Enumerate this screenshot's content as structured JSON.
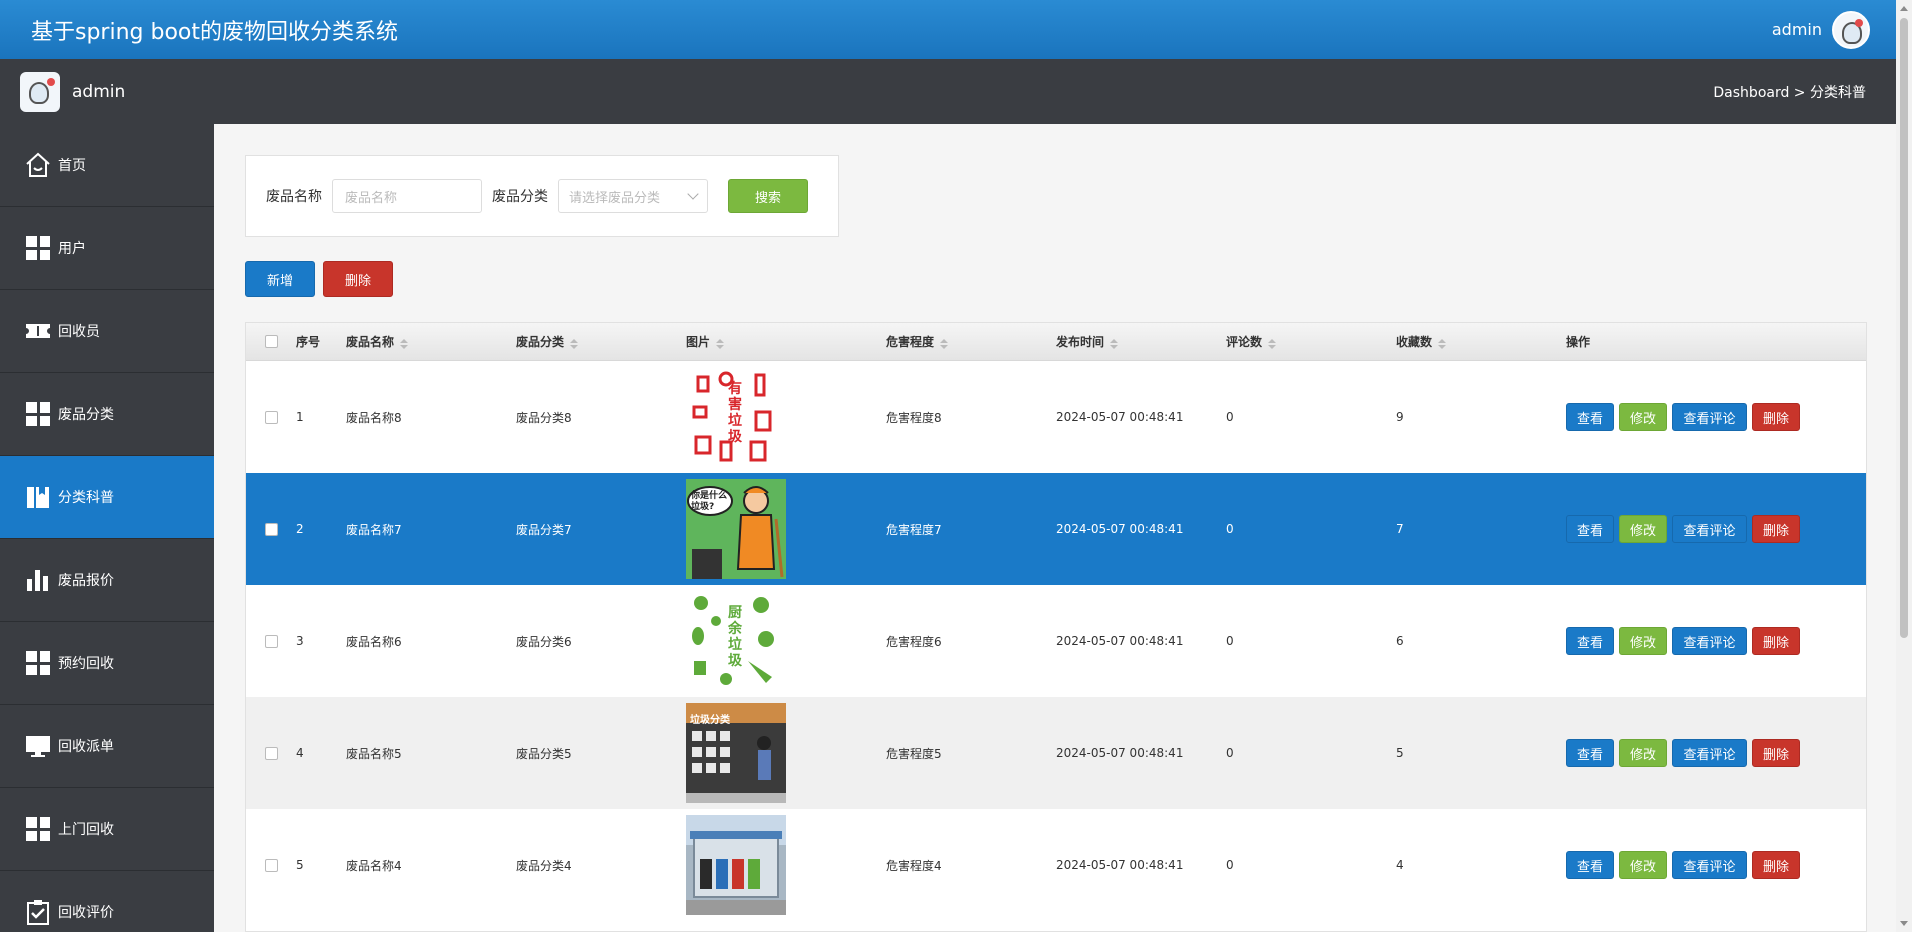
{
  "header": {
    "title": "基于spring boot的废物回收分类系统",
    "username": "admin"
  },
  "subbar": {
    "username": "admin",
    "breadcrumb": "Dashboard > 分类科普"
  },
  "sidebar": {
    "items": [
      {
        "label": "首页",
        "icon": "home-icon"
      },
      {
        "label": "用户",
        "icon": "grid-icon"
      },
      {
        "label": "回收员",
        "icon": "ticket-icon"
      },
      {
        "label": "废品分类",
        "icon": "grid-icon"
      },
      {
        "label": "分类科普",
        "icon": "book-icon",
        "active": true
      },
      {
        "label": "废品报价",
        "icon": "bar-chart-icon"
      },
      {
        "label": "预约回收",
        "icon": "grid-icon"
      },
      {
        "label": "回收派单",
        "icon": "monitor-icon"
      },
      {
        "label": "上门回收",
        "icon": "grid-icon"
      },
      {
        "label": "回收评价",
        "icon": "clipboard-check-icon"
      }
    ]
  },
  "search": {
    "name_label": "废品名称",
    "name_placeholder": "废品名称",
    "category_label": "废品分类",
    "category_placeholder": "请选择废品分类",
    "search_button": "搜索"
  },
  "toolbar": {
    "add_label": "新增",
    "delete_label": "删除"
  },
  "table": {
    "columns": [
      "序号",
      "废品名称",
      "废品分类",
      "图片",
      "危害程度",
      "发布时间",
      "评论数",
      "收藏数",
      "操作"
    ],
    "actions": {
      "view": "查看",
      "edit": "修改",
      "comments": "查看评论",
      "delete": "删除"
    },
    "rows": [
      {
        "no": "1",
        "name": "废品名称8",
        "category": "废品分类8",
        "level": "危害程度8",
        "time": "2024-05-07 00:48:41",
        "comments": "0",
        "favorites": "9",
        "image": "hazardous-waste-icon",
        "image_text": "有害垃圾"
      },
      {
        "no": "2",
        "name": "废品名称7",
        "category": "废品分类7",
        "level": "危害程度7",
        "time": "2024-05-07 00:48:41",
        "comments": "0",
        "favorites": "7",
        "image": "cartoon-worker-image",
        "image_text": "你是什么垃圾?"
      },
      {
        "no": "3",
        "name": "废品名称6",
        "category": "废品分类6",
        "level": "危害程度6",
        "time": "2024-05-07 00:48:41",
        "comments": "0",
        "favorites": "6",
        "image": "kitchen-waste-icon",
        "image_text": "厨余垃圾"
      },
      {
        "no": "4",
        "name": "废品名称5",
        "category": "废品分类5",
        "level": "危害程度5",
        "time": "2024-05-07 00:48:41",
        "comments": "0",
        "favorites": "5",
        "image": "sorting-station-photo",
        "image_text": "垃圾分类"
      },
      {
        "no": "5",
        "name": "废品名称4",
        "category": "废品分类4",
        "level": "危害程度4",
        "time": "2024-05-07 00:48:41",
        "comments": "0",
        "favorites": "4",
        "image": "recycling-kiosk-photo",
        "image_text": ""
      }
    ]
  },
  "colors": {
    "primary": "#1a7ac8",
    "green": "#7cb940",
    "red": "#c8352b",
    "sidebar": "#3a3d42"
  }
}
